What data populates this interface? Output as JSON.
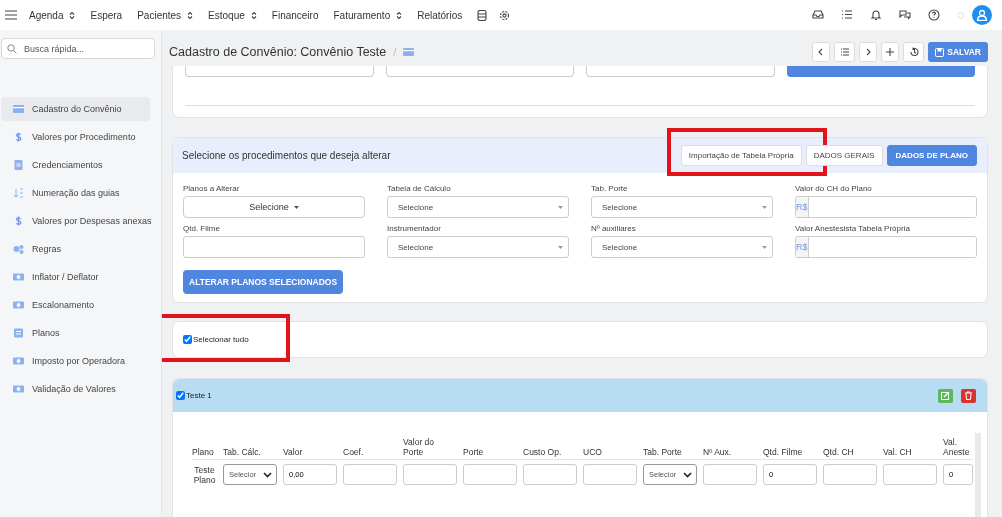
{
  "nav": {
    "items": [
      {
        "label": "Agenda",
        "dropdown": true
      },
      {
        "label": "Espera",
        "dropdown": false
      },
      {
        "label": "Pacientes",
        "dropdown": true
      },
      {
        "label": "Estoque",
        "dropdown": true
      },
      {
        "label": "Financeiro",
        "dropdown": false
      },
      {
        "label": "Faturamento",
        "dropdown": true
      },
      {
        "label": "Relatórios",
        "dropdown": false
      }
    ]
  },
  "search": {
    "placeholder": "Busca rápida..."
  },
  "sidebar": {
    "items": [
      {
        "label": "Cadastro do Convênio",
        "kind": "card",
        "selected": true
      },
      {
        "label": "Valores por Procedimento",
        "kind": "dollar",
        "selected": false
      },
      {
        "label": "Credenciamentos",
        "kind": "doc",
        "selected": false
      },
      {
        "label": "Numeração das guias",
        "kind": "sort",
        "selected": false
      },
      {
        "label": "Valores por Despesas anexas",
        "kind": "dollar",
        "selected": false
      },
      {
        "label": "Regras",
        "kind": "gears",
        "selected": false
      },
      {
        "label": "Inflator / Deflator",
        "kind": "money",
        "selected": false
      },
      {
        "label": "Escalonamento",
        "kind": "money",
        "selected": false
      },
      {
        "label": "Planos",
        "kind": "list",
        "selected": false
      },
      {
        "label": "Imposto por Operadora",
        "kind": "money",
        "selected": false
      },
      {
        "label": "Validação de Valores",
        "kind": "money",
        "selected": false
      }
    ]
  },
  "page": {
    "title": "Cadastro de Convênio: Convênio Teste",
    "separator": "/",
    "save_label": "SALVAR"
  },
  "bulk_panel": {
    "title": "Selecione os procedimentos que deseja alterar",
    "tabs": [
      {
        "label": "Importação de Tabela Própria",
        "selected": false,
        "highlighted": true
      },
      {
        "label": "DADOS GERAIS",
        "selected": false,
        "highlighted": false
      },
      {
        "label": "DADOS DE PLANO",
        "selected": true,
        "highlighted": false
      }
    ],
    "fields": [
      {
        "label": "Planos a Alterar",
        "kind": "dropdown",
        "value": "Selecione"
      },
      {
        "label": "Tabela de Cálculo",
        "kind": "select",
        "value": "Selecione"
      },
      {
        "label": "Tab. Porte",
        "kind": "select",
        "value": "Selecione"
      },
      {
        "label": "Valor do CH do Plano",
        "kind": "currency",
        "prefix": "R$"
      },
      {
        "label": "Qtd. Filme",
        "kind": "input"
      },
      {
        "label": "Instrumentador",
        "kind": "select",
        "value": "Selecione"
      },
      {
        "label": "Nº auxiliares",
        "kind": "select",
        "value": "Selecione"
      },
      {
        "label": "Valor Anestesista Tabela Própria",
        "kind": "currency",
        "prefix": "R$"
      }
    ],
    "apply_label": "ALTERAR PLANOS SELECIONADOS"
  },
  "select_all": {
    "label": "Selecionar tudo",
    "checked": true,
    "highlighted": true
  },
  "plan_group": {
    "name": "Teste 1",
    "checked": true,
    "columns": [
      "Plano",
      "Tab. Cálc.",
      "Valor",
      "Coef.",
      "Valor do Porte",
      "Porte",
      "Custo Op.",
      "UCO",
      "Tab. Porte",
      "Nº Aux.",
      "Qtd. Filme",
      "Qtd. CH",
      "Val. CH",
      "Val. Aneste"
    ],
    "rows": [
      {
        "cells": [
          {
            "kind": "text",
            "value": "Teste Plano"
          },
          {
            "kind": "select",
            "value": "Selecior"
          },
          {
            "kind": "input",
            "value": "0,00"
          },
          {
            "kind": "input"
          },
          {
            "kind": "input"
          },
          {
            "kind": "input"
          },
          {
            "kind": "input"
          },
          {
            "kind": "input"
          },
          {
            "kind": "select",
            "value": "Selecior"
          },
          {
            "kind": "input"
          },
          {
            "kind": "input",
            "value": "0"
          },
          {
            "kind": "input"
          },
          {
            "kind": "input"
          },
          {
            "kind": "input",
            "value": "0"
          }
        ]
      }
    ]
  }
}
